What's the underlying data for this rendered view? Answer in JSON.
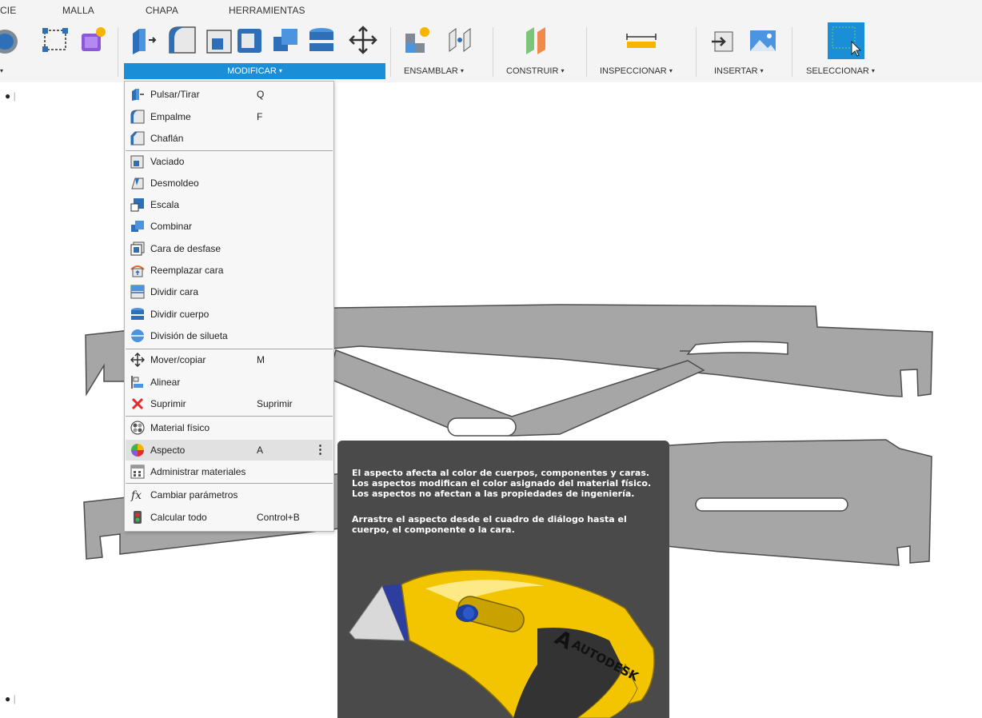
{
  "tabs": [
    "CIE",
    "MALLA",
    "CHAPA",
    "HERRAMIENTAS"
  ],
  "toolbar": {
    "groups": {
      "modificar": "MODIFICAR",
      "ensamblar": "ENSAMBLAR",
      "construir": "CONSTRUIR",
      "inspeccionar": "INSPECCIONAR",
      "insertar": "INSERTAR",
      "seleccionar": "SELECCIONAR"
    },
    "caret": "▾",
    "active_color": "#1a8fd8"
  },
  "menu": {
    "items": [
      {
        "label": "Pulsar/Tirar",
        "shortcut": "Q",
        "icon": "press-pull-icon"
      },
      {
        "label": "Empalme",
        "shortcut": "F",
        "icon": "fillet-icon"
      },
      {
        "label": "Chaflán",
        "shortcut": "",
        "icon": "chamfer-icon"
      },
      {
        "label": "Vaciado",
        "shortcut": "",
        "icon": "shell-icon"
      },
      {
        "label": "Desmoldeo",
        "shortcut": "",
        "icon": "draft-icon"
      },
      {
        "label": "Escala",
        "shortcut": "",
        "icon": "scale-icon"
      },
      {
        "label": "Combinar",
        "shortcut": "",
        "icon": "combine-icon"
      },
      {
        "label": "Cara de desfase",
        "shortcut": "",
        "icon": "offset-face-icon"
      },
      {
        "label": "Reemplazar cara",
        "shortcut": "",
        "icon": "replace-face-icon"
      },
      {
        "label": "Dividir cara",
        "shortcut": "",
        "icon": "split-face-icon"
      },
      {
        "label": "Dividir cuerpo",
        "shortcut": "",
        "icon": "split-body-icon"
      },
      {
        "label": "División de silueta",
        "shortcut": "",
        "icon": "silhouette-split-icon"
      },
      {
        "label": "Mover/copiar",
        "shortcut": "M",
        "icon": "move-copy-icon"
      },
      {
        "label": "Alinear",
        "shortcut": "",
        "icon": "align-icon"
      },
      {
        "label": "Suprimir",
        "shortcut": "Suprimir",
        "icon": "delete-icon"
      },
      {
        "label": "Material físico",
        "shortcut": "",
        "icon": "physical-material-icon"
      },
      {
        "label": "Aspecto",
        "shortcut": "A",
        "icon": "appearance-icon"
      },
      {
        "label": "Administrar materiales",
        "shortcut": "",
        "icon": "manage-materials-icon"
      },
      {
        "label": "Cambiar parámetros",
        "shortcut": "",
        "icon": "change-parameters-icon"
      },
      {
        "label": "Calcular todo",
        "shortcut": "Control+B",
        "icon": "compute-all-icon"
      }
    ],
    "more": "⋮",
    "highlighted": "Aspecto"
  },
  "tooltip": {
    "lines": [
      "El aspecto afecta al color de cuerpos, componentes y caras.",
      "Los aspectos modifican el color asignado del material físico.",
      "Los aspectos no afectan a las propiedades de ingeniería."
    ],
    "lines2": [
      "Arrastre el aspecto desde el cuadro de diálogo hasta el",
      "cuerpo, el componente o la cara."
    ],
    "brand": "AUTODESK",
    "colors": {
      "panel": "#4a4a4a",
      "knife_body": "#f2c500",
      "knife_grip": "#333333"
    }
  },
  "viewport": {
    "colors": {
      "part_fill": "#a6a6a6",
      "part_edge": "#4d4d4d"
    }
  }
}
